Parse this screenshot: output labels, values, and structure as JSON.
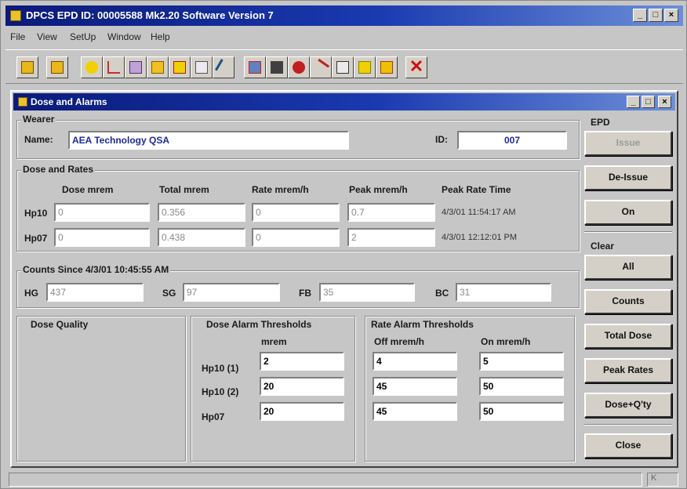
{
  "app": {
    "title": "DPCS EPD ID: 00005588 Mk2.20 Software Version 7",
    "menu": [
      "File",
      "View",
      "SetUp",
      "Window",
      "Help"
    ],
    "window_controls": [
      "_",
      "□",
      "×"
    ]
  },
  "toolbar": {
    "icons": [
      "open-icon",
      "save-icon",
      "person-icon",
      "chart-icon",
      "card-icon",
      "folder-icon",
      "edit-icon",
      "list-icon",
      "pen-icon",
      "settings-icon",
      "grid-icon",
      "gear-icon",
      "arrow-icon",
      "table-icon",
      "key-icon",
      "hourglass-icon",
      "exit-x-icon"
    ]
  },
  "dialog": {
    "title": "Dose and Alarms",
    "controls": [
      "_",
      "□",
      "×"
    ],
    "wearer": {
      "group_label": "Wearer",
      "name_label": "Name:",
      "name_value": "AEA Technology QSA",
      "id_label": "ID:",
      "id_value": "007"
    },
    "dose_rates": {
      "group_label": "Dose and Rates",
      "columns": [
        "Dose mrem",
        "Total mrem",
        "Rate mrem/h",
        "Peak mrem/h",
        "Peak Rate Time"
      ],
      "rows": [
        {
          "label": "Hp10",
          "dose": "0",
          "total": "0.356",
          "rate": "0",
          "peak": "0.7",
          "peak_time": "4/3/01 11:54:17 AM"
        },
        {
          "label": "Hp07",
          "dose": "0",
          "total": "0.438",
          "rate": "0",
          "peak": "2",
          "peak_time": "4/3/01 12:12:01 PM"
        }
      ]
    },
    "counts": {
      "group_label": "Counts Since 4/3/01 10:45:55 AM",
      "hg_label": "HG",
      "hg_value": "437",
      "sg_label": "SG",
      "sg_value": "97",
      "fb_label": "FB",
      "fb_value": "35",
      "bc_label": "BC",
      "bc_value": "31"
    },
    "dose_quality": {
      "group_label": "Dose Quality"
    },
    "dose_alarm": {
      "group_label": "Dose Alarm Thresholds",
      "unit": "mrem",
      "rows": [
        {
          "label": "Hp10 (1)",
          "value": "2"
        },
        {
          "label": "Hp10 (2)",
          "value": "20"
        },
        {
          "label": "Hp07",
          "value": "20"
        }
      ]
    },
    "rate_alarm": {
      "group_label": "Rate Alarm Thresholds",
      "off_header": "Off mrem/h",
      "on_header": "On mrem/h",
      "rows": [
        {
          "off": "4",
          "on": "5"
        },
        {
          "off": "45",
          "on": "50"
        },
        {
          "off": "45",
          "on": "50"
        }
      ]
    },
    "epd": {
      "group_label": "EPD",
      "issue": "Issue",
      "reissue": "De-Issue",
      "on": "On"
    },
    "clear": {
      "group_label": "Clear",
      "all": "All",
      "counts": "Counts",
      "total_dose": "Total Dose",
      "peak_rates": "Peak Rates",
      "dose_qty": "Dose+Q'ty"
    },
    "close": "Close"
  },
  "status": {
    "right": "K"
  },
  "colors": {
    "title_dark": "#0a1a7a",
    "title_light": "#6d8fd8",
    "face": "#c6c6c6",
    "name_text": "#1e2a9a"
  }
}
